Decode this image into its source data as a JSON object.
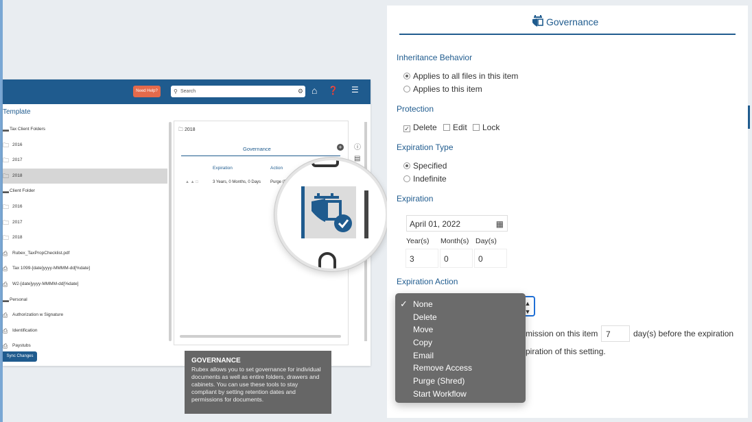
{
  "app": {
    "help_label": "Need Help?",
    "search_placeholder": "Search",
    "title": "Template",
    "tree": [
      {
        "label": "Tax Client Folders",
        "icon": "cabinet-icon",
        "level": 0
      },
      {
        "label": "2016",
        "icon": "folder-icon",
        "level": 1
      },
      {
        "label": "2017",
        "icon": "folder-icon",
        "level": 1
      },
      {
        "label": "2018",
        "icon": "folder-icon",
        "level": 1,
        "selected": true
      },
      {
        "label": "Client Folder",
        "icon": "cabinet-icon",
        "level": 0
      },
      {
        "label": "2016",
        "icon": "folder-icon",
        "level": 1
      },
      {
        "label": "2017",
        "icon": "folder-icon",
        "level": 1
      },
      {
        "label": "2018",
        "icon": "folder-icon",
        "level": 1
      },
      {
        "label": "Rubex_TaxPropChecklist.pdf",
        "icon": "pdf-icon",
        "level": 1
      },
      {
        "label": "Tax 1099-[date]yyyy-MMMM-dd[%date]",
        "icon": "document-icon",
        "level": 1
      },
      {
        "label": "W2-[date]yyyy-MMMM-dd[%date]",
        "icon": "document-icon",
        "level": 1
      },
      {
        "label": "Personal",
        "icon": "cabinet-icon",
        "level": 0
      },
      {
        "label": "Authorization w Signature",
        "icon": "document-icon",
        "level": 1
      },
      {
        "label": "Identification",
        "icon": "document-icon",
        "level": 1
      },
      {
        "label": "Paystubs",
        "icon": "document-icon",
        "level": 1
      }
    ],
    "sync_label": "Sync Changes",
    "panel": {
      "folder_label": "2018",
      "gov_title": "Governance",
      "col_expiration": "Expiration",
      "col_action": "Action",
      "row_expiration": "3 Years, 0 Months, 0 Days",
      "row_action": "Purge (Shre"
    }
  },
  "tooltip": {
    "title": "GOVERNANCE",
    "body": "Rubex allows you to set governance for individual documents as well as entire folders, drawers and cabinets. You can use these tools to stay compliant by setting retention dates and permissions for documents."
  },
  "governance": {
    "title": "Governance",
    "inheritance": {
      "title": "Inheritance Behavior",
      "options": [
        "Applies to all files in this item",
        "Applies to this item"
      ],
      "selected": 0
    },
    "protection": {
      "title": "Protection",
      "items": [
        {
          "label": "Delete",
          "checked": true
        },
        {
          "label": "Edit",
          "checked": false
        },
        {
          "label": "Lock",
          "checked": false
        }
      ]
    },
    "expiration_type": {
      "title": "Expiration Type",
      "options": [
        "Specified",
        "Indefinite"
      ],
      "selected": 0
    },
    "expiration": {
      "title": "Expiration",
      "date": "April 01, 2022",
      "years_label": "Year(s)",
      "months_label": "Month(s)",
      "days_label": "Day(s)",
      "years": "3",
      "months": "0",
      "days": "0"
    },
    "expiration_action": {
      "title": "Expiration Action",
      "options": [
        "None",
        "Delete",
        "Move",
        "Copy",
        "Email",
        "Remove Access",
        "Purge (Shred)",
        "Start Workflow"
      ],
      "selected": 0
    },
    "notify_text_1": "mission on this item",
    "notify_days": "7",
    "notify_text_2": "day(s) before the expiration",
    "notify_text_3": "piration of this setting."
  },
  "colors": {
    "brand_blue": "#1f5b8e",
    "help_orange": "#e46a4b",
    "tooltip_gray": "#666666",
    "dropdown_gray": "#6b6b6b"
  }
}
